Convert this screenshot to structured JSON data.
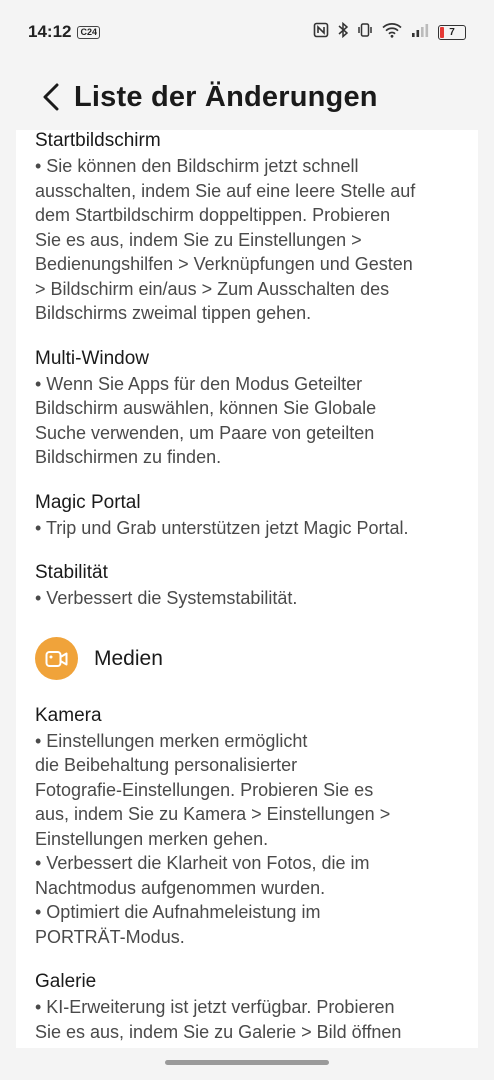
{
  "status": {
    "time": "14:12",
    "badge": "C24",
    "battery": "7"
  },
  "header": {
    "title": "Liste der Änderungen"
  },
  "sections_top": [
    {
      "title": "Startbildschirm",
      "text": "• Sie können den Bildschirm jetzt schnell\nausschalten, indem Sie auf eine leere Stelle auf\ndem Startbildschirm doppeltippen. Probieren\nSie es aus, indem Sie zu Einstellungen >\nBedienungshilfen > Verknüpfungen und Gesten\n> Bildschirm ein/aus > Zum Ausschalten des\nBildschirms zweimal tippen gehen."
    },
    {
      "title": "Multi-Window",
      "text": "• Wenn Sie Apps für den Modus Geteilter\nBildschirm auswählen, können Sie Globale\nSuche verwenden, um Paare von geteilten\nBildschirmen zu finden."
    },
    {
      "title": "Magic Portal",
      "text": "• Trip und Grab unterstützen jetzt Magic Portal."
    },
    {
      "title": "Stabilität",
      "text": "• Verbessert die Systemstabilität."
    }
  ],
  "category": {
    "label": "Medien",
    "icon": "video-camera-icon",
    "color": "#f0a33a"
  },
  "sections_media": [
    {
      "title": "Kamera",
      "text": "• Einstellungen merken ermöglicht\ndie Beibehaltung personalisierter\nFotografie-Einstellungen. Probieren Sie es\naus, indem Sie zu Kamera > Einstellungen >\nEinstellungen merken gehen.\n• Verbessert die Klarheit von Fotos, die im\nNachtmodus aufgenommen wurden.\n• Optimiert die Aufnahmeleistung im\nPORTRÄT-Modus."
    },
    {
      "title": "Galerie",
      "text": "• KI-Erweiterung ist jetzt verfügbar. Probieren\nSie es aus, indem Sie zu Galerie > Bild öffnen"
    }
  ]
}
